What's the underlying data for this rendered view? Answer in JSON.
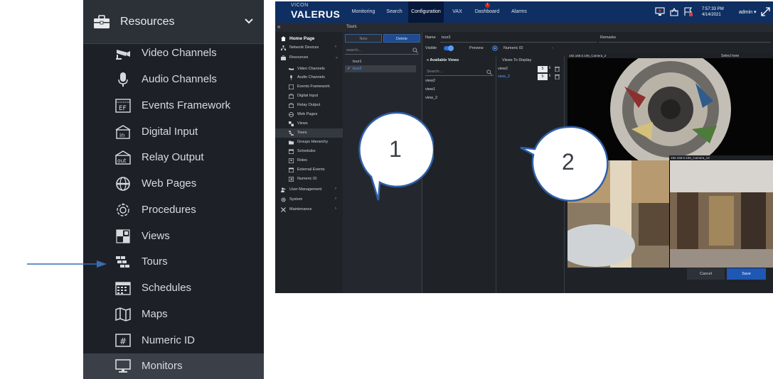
{
  "zoom_sidebar": {
    "header_label": "Resources",
    "items": [
      {
        "label": "Video Channels",
        "icon": "camera-icon"
      },
      {
        "label": "Audio Channels",
        "icon": "microphone-icon"
      },
      {
        "label": "Events Framework",
        "icon": "events-framework-icon"
      },
      {
        "label": "Digital Input",
        "icon": "digital-input-icon"
      },
      {
        "label": "Relay Output",
        "icon": "relay-output-icon"
      },
      {
        "label": "Web Pages",
        "icon": "globe-icon"
      },
      {
        "label": "Procedures",
        "icon": "procedures-icon"
      },
      {
        "label": "Views",
        "icon": "views-grid-icon"
      },
      {
        "label": "Tours",
        "icon": "tours-icon"
      },
      {
        "label": "Schedules",
        "icon": "calendar-icon"
      },
      {
        "label": "Maps",
        "icon": "map-icon"
      },
      {
        "label": "Numeric ID",
        "icon": "hash-icon"
      },
      {
        "label": "Monitors",
        "icon": "monitor-icon"
      }
    ]
  },
  "app": {
    "logo_small": "VICON",
    "logo_main": "VALERUS",
    "tabs": [
      "Monitoring",
      "Search",
      "Configuration",
      "VAX",
      "Dashboard",
      "Alarms"
    ],
    "active_tab": "Configuration",
    "dashboard_badge": "!",
    "clock_time": "7:57:33 PM",
    "clock_date": "4/14/2021",
    "user": "admin",
    "breadcrumb": "Tours",
    "collapse": "«"
  },
  "nav": {
    "home": "Home Page",
    "network_devices": "Network Devices",
    "resources": "Resources",
    "sub_items": [
      "Video Channels",
      "Audio Channels",
      "Events Framework",
      "Digital Input",
      "Relay Output",
      "Web Pages",
      "Views",
      "Tours",
      "Groups Hierarchy",
      "Schedules",
      "Roles",
      "External Events",
      "Numeric ID"
    ],
    "user_management": "User Management",
    "system": "System",
    "maintenance": "Maintenance"
  },
  "tours": {
    "new_label": "New",
    "delete_label": "Delete",
    "search_placeholder": "search...",
    "items": [
      "tour1",
      "tour2"
    ]
  },
  "editor": {
    "name_label": "Name",
    "name_value": "tour2",
    "remarks_label": "Remarks",
    "visible_label": "Visible",
    "preview_label": "Preview",
    "numeric_id_label": "Numeric ID",
    "numeric_id_value": "-",
    "available_views_label": "Available Views",
    "search_placeholder": "Search...",
    "available_views": [
      "view2",
      "view1",
      "view_2"
    ],
    "views_to_display_label": "Views To Display",
    "views_to_display": [
      {
        "name": "view2",
        "seconds": "5"
      },
      {
        "name": "view_2",
        "seconds": "5"
      }
    ],
    "camera_1": "192.168.0.105_Camera_2",
    "camera_2": "192.168.0.105_Camera_14",
    "select_here": "Select here",
    "cancel_label": "Cancel",
    "save_label": "Save"
  },
  "callouts": [
    "1",
    "2"
  ]
}
